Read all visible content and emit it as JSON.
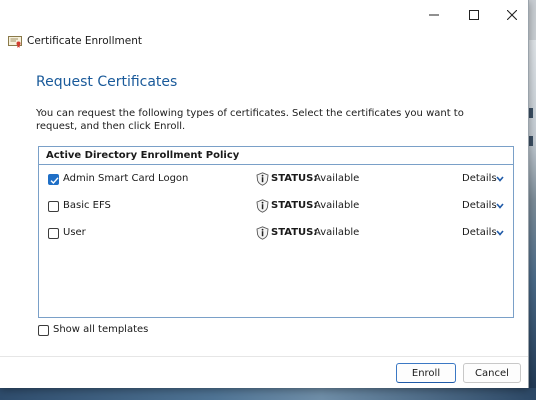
{
  "window": {
    "title": "Certificate Enrollment",
    "caption_buttons": {
      "minimize": "minimize-icon",
      "maximize": "maximize-icon",
      "close": "close-icon"
    }
  },
  "page": {
    "heading": "Request Certificates",
    "intro": "You can request the following types of certificates. Select the certificates you want to request, and then click Enroll."
  },
  "policy": {
    "header": "Active Directory Enrollment Policy",
    "status_key": "STATUS:",
    "details_label": "Details",
    "items": [
      {
        "name": "Admin Smart Card Logon",
        "checked": true,
        "status": "Available"
      },
      {
        "name": "Basic EFS",
        "checked": false,
        "status": "Available"
      },
      {
        "name": "User",
        "checked": false,
        "status": "Available"
      }
    ]
  },
  "show_all": {
    "label": "Show all templates",
    "checked": false
  },
  "buttons": {
    "enroll": "Enroll",
    "cancel": "Cancel"
  },
  "colors": {
    "heading": "#1a5a9a",
    "accent": "#1f6fc6",
    "box_border": "#7aa0c8"
  }
}
